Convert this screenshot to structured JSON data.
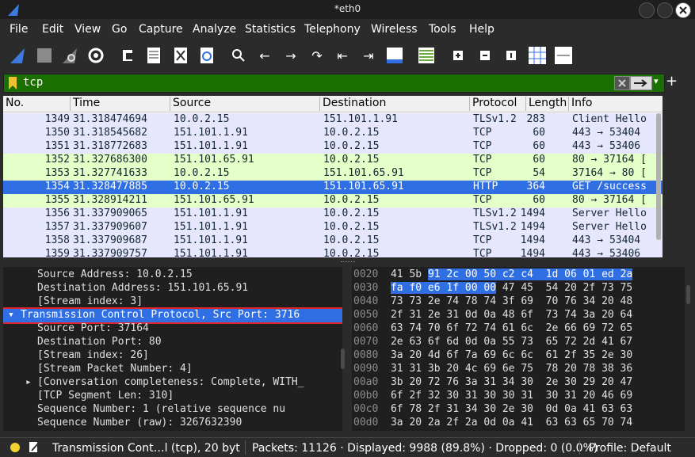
{
  "window": {
    "title": "*eth0"
  },
  "menubar": {
    "items": [
      "File",
      "Edit",
      "View",
      "Go",
      "Capture",
      "Analyze",
      "Statistics",
      "Telephony",
      "Wireless",
      "Tools",
      "Help"
    ]
  },
  "toolbar": {
    "icons": [
      "shark-fin-start-icon",
      "stop-square-icon",
      "restart-fin-icon",
      "gear-options-icon",
      "open-file-icon",
      "save-file-icon",
      "close-file-icon",
      "reload-icon",
      "search-icon",
      "go-back-icon",
      "go-forward-icon",
      "go-to-packet-icon",
      "first-packet-icon",
      "last-packet-icon",
      "autoscroll-icon",
      "colorize-icon",
      "zoom-in-icon",
      "zoom-out-icon",
      "normal-size-icon",
      "resize-columns-icon"
    ]
  },
  "filter": {
    "value": "tcp",
    "accent": "#1b6e00"
  },
  "packet_list": {
    "headers": [
      "No.",
      "Time",
      "Source",
      "Destination",
      "Protocol",
      "Length",
      "Info"
    ],
    "rows": [
      {
        "no": "1349",
        "time": "31.318474694",
        "src": "10.0.2.15",
        "dst": "151.101.1.91",
        "proto": "TLSv1.2",
        "len": "283",
        "info": "Client Hello",
        "style": "tcp"
      },
      {
        "no": "1350",
        "time": "31.318545682",
        "src": "151.101.1.91",
        "dst": "10.0.2.15",
        "proto": "TCP",
        "len": "60",
        "info": "443 → 53404",
        "style": "tcp"
      },
      {
        "no": "1351",
        "time": "31.318772683",
        "src": "151.101.1.91",
        "dst": "10.0.2.15",
        "proto": "TCP",
        "len": "60",
        "info": "443 → 53406",
        "style": "tcp"
      },
      {
        "no": "1352",
        "time": "31.327686300",
        "src": "151.101.65.91",
        "dst": "10.0.2.15",
        "proto": "TCP",
        "len": "60",
        "info": "80 → 37164 [",
        "style": "tcpg"
      },
      {
        "no": "1353",
        "time": "31.327741633",
        "src": "10.0.2.15",
        "dst": "151.101.65.91",
        "proto": "TCP",
        "len": "54",
        "info": "37164 → 80 [",
        "style": "tcpg"
      },
      {
        "no": "1354",
        "time": "31.328477885",
        "src": "10.0.2.15",
        "dst": "151.101.65.91",
        "proto": "HTTP",
        "len": "364",
        "info": "GET /success",
        "style": "sel"
      },
      {
        "no": "1355",
        "time": "31.328914211",
        "src": "151.101.65.91",
        "dst": "10.0.2.15",
        "proto": "TCP",
        "len": "60",
        "info": "80 → 37164 [",
        "style": "tcpg"
      },
      {
        "no": "1356",
        "time": "31.337909065",
        "src": "151.101.1.91",
        "dst": "10.0.2.15",
        "proto": "TLSv1.2",
        "len": "1494",
        "info": "Server Hello",
        "style": "tcp"
      },
      {
        "no": "1357",
        "time": "31.337909607",
        "src": "151.101.1.91",
        "dst": "10.0.2.15",
        "proto": "TLSv1.2",
        "len": "1494",
        "info": "Server Hello",
        "style": "tcp"
      },
      {
        "no": "1358",
        "time": "31.337909687",
        "src": "151.101.1.91",
        "dst": "10.0.2.15",
        "proto": "TCP",
        "len": "1494",
        "info": "443 → 53404",
        "style": "tcp"
      },
      {
        "no": "1359",
        "time": "31.337909757",
        "src": "151.101.1.91",
        "dst": "10.0.2.15",
        "proto": "TCP",
        "len": "1494",
        "info": "443 → 53406",
        "style": "tcp"
      }
    ]
  },
  "details": {
    "rows": [
      {
        "text": "Source Address: 10.0.2.15",
        "indent": 1
      },
      {
        "text": "Destination Address: 151.101.65.91",
        "indent": 1
      },
      {
        "text": "[Stream index: 3]",
        "indent": 1
      },
      {
        "text": "Transmission Control Protocol, Src Port: 3716",
        "indent": 0,
        "arrow": "▾",
        "selected": true
      },
      {
        "text": "Source Port: 37164",
        "indent": 1
      },
      {
        "text": "Destination Port: 80",
        "indent": 1
      },
      {
        "text": "[Stream index: 26]",
        "indent": 1
      },
      {
        "text": "[Stream Packet Number: 4]",
        "indent": 1
      },
      {
        "text": "[Conversation completeness: Complete, WITH_",
        "indent": 1,
        "arrow": "▸"
      },
      {
        "text": "[TCP Segment Len: 310]",
        "indent": 1
      },
      {
        "text": "Sequence Number: 1    (relative sequence nu",
        "indent": 1
      },
      {
        "text": "Sequence Number (raw): 3267632390",
        "indent": 1
      }
    ]
  },
  "hex": {
    "rows": [
      {
        "off": "0020",
        "pre": "41 5b ",
        "hl": "91 2c 00 50 c2 c4  1d 06 01 ed 2a",
        "post": ""
      },
      {
        "off": "0030",
        "pre": "",
        "hl": "fa f0 e6 1f 00 00",
        "post": " 47 45  54 20 2f 73 75"
      },
      {
        "off": "0040",
        "pre": "73 73 2e 74 78 74 3f 69  70 76 34 20 48",
        "hl": "",
        "post": ""
      },
      {
        "off": "0050",
        "pre": "2f 31 2e 31 0d 0a 48 6f  73 74 3a 20 64",
        "hl": "",
        "post": ""
      },
      {
        "off": "0060",
        "pre": "63 74 70 6f 72 74 61 6c  2e 66 69 72 65",
        "hl": "",
        "post": ""
      },
      {
        "off": "0070",
        "pre": "2e 63 6f 6d 0d 0a 55 73  65 72 2d 41 67",
        "hl": "",
        "post": ""
      },
      {
        "off": "0080",
        "pre": "3a 20 4d 6f 7a 69 6c 6c  61 2f 35 2e 30",
        "hl": "",
        "post": ""
      },
      {
        "off": "0090",
        "pre": "31 31 3b 20 4c 69 6e 75  78 20 78 38 36",
        "hl": "",
        "post": ""
      },
      {
        "off": "00a0",
        "pre": "3b 20 72 76 3a 31 34 30  2e 30 29 20 47",
        "hl": "",
        "post": ""
      },
      {
        "off": "00b0",
        "pre": "6f 2f 32 30 31 30 30 31  30 31 20 46 69",
        "hl": "",
        "post": ""
      },
      {
        "off": "00c0",
        "pre": "6f 78 2f 31 34 30 2e 30  0d 0a 41 63 63",
        "hl": "",
        "post": ""
      },
      {
        "off": "00d0",
        "pre": "3a 20 2a 2f 2a 0d 0a 41  63 63 65 70 74",
        "hl": "",
        "post": ""
      }
    ]
  },
  "status": {
    "field": "Transmission Cont…l (tcp), 20 bytes",
    "packets": "Packets: 11126 · Displayed: 9988 (89.8%) · Dropped: 0 (0.0%)",
    "profile": "Profile: Default"
  }
}
